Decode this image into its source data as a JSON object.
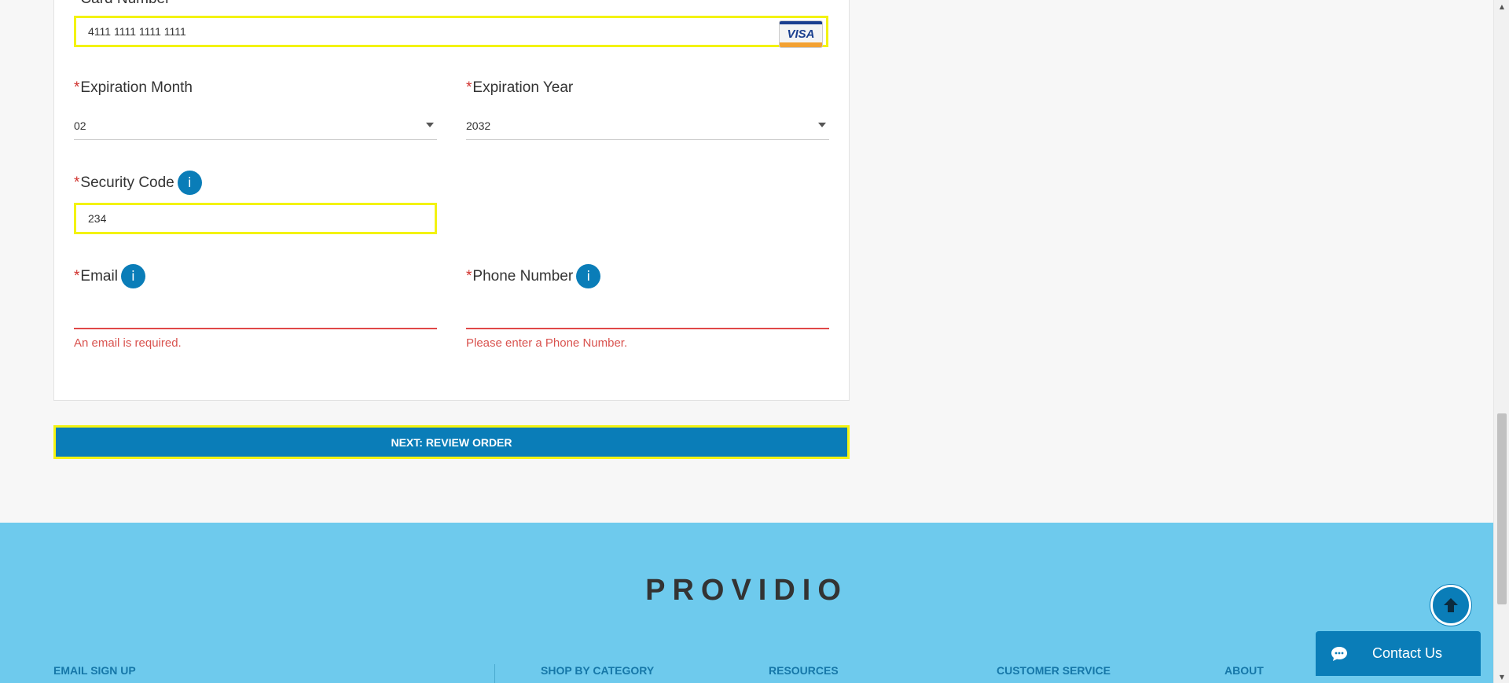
{
  "payment": {
    "card_number_label": "Card Number",
    "card_number_value": "4111 1111 1111 1111",
    "card_brand": "VISA",
    "required_marker": "*",
    "exp_month_label": "Expiration Month",
    "exp_month_value": "02",
    "exp_year_label": "Expiration Year",
    "exp_year_value": "2032",
    "security_code_label": "Security Code",
    "security_code_value": "234",
    "email_label": "Email",
    "email_error": "An email is required.",
    "phone_label": "Phone Number",
    "phone_error": "Please enter a Phone Number.",
    "info_glyph": "i"
  },
  "actions": {
    "next_label": "NEXT: REVIEW ORDER"
  },
  "footer": {
    "logo_text": "PROVIDIO",
    "headings": [
      "EMAIL SIGN UP",
      "SHOP BY CATEGORY",
      "RESOURCES",
      "CUSTOMER SERVICE",
      "ABOUT"
    ]
  },
  "widgets": {
    "contact_label": "Contact Us"
  },
  "colors": {
    "accent_blue": "#0a7db8",
    "footer_bg": "#6ecaed",
    "error_red": "#d9534f",
    "focus_yellow": "#f3f312"
  }
}
